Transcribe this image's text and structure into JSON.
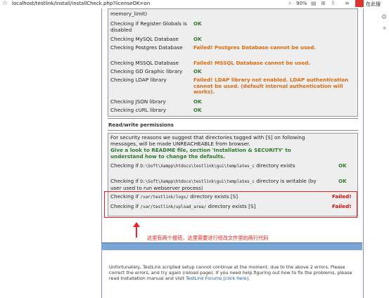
{
  "browser": {
    "url": "localhost/testlink/install/installCheck.php?licenseOK=on",
    "zoom": "90%",
    "search_label": "在此搜",
    "icons": [
      "bookmark-star-icon",
      "reader-icon",
      "extensions-icon",
      "menu-icon",
      "search-icon"
    ]
  },
  "checks_top": [
    {
      "label": "memory_limit)",
      "status": "",
      "status_class": ""
    },
    {
      "label": "Checking if Register Globals is disabled",
      "status": "OK",
      "status_class": "ok"
    },
    {
      "label": "Checking MySQL Database",
      "status": "OK",
      "status_class": "ok"
    },
    {
      "label": "Checking Postgres Database",
      "status": "Failed! Postgres Database cannot be used.",
      "status_class": "fail"
    },
    {
      "label": "Checking MSSQL Database",
      "status": "Failed! MSSQL Database cannot be used.",
      "status_class": "fail"
    },
    {
      "label": "Checking GD Graphic library",
      "status": "OK",
      "status_class": "ok"
    },
    {
      "label": "Checking LDAP library",
      "status": "Failed! LDAP library not enabled. LDAP authentication cannot be used. (default internal authentication will works).",
      "status_class": "fail"
    },
    {
      "label": "Checking JSON library",
      "status": "OK",
      "status_class": "ok"
    },
    {
      "label": "Checking cURL library",
      "status": "OK",
      "status_class": "ok"
    }
  ],
  "rw": {
    "title": "Read/write permissions",
    "intro": "For security reasons we suggest that directories tagged with [S] on following messages, will be made UNREACHEABLE from browser.",
    "advice": "Give a look to README file, section 'Installation & SECURITY' to understand how to change the defaults.",
    "rows": [
      {
        "prefix": "Checking if",
        "path": "D:\\Soft\\Xampp\\htdocs\\testlink\\gui\\templates_c",
        "suffix": "directory exists",
        "status": "OK"
      },
      {
        "prefix": "Checking if",
        "path": "D:\\Soft\\Xampp\\htdocs\\testlink\\gui\\templates_c",
        "suffix": "directory is writable (by user used to run webserver process)",
        "status": "OK"
      },
      {
        "prefix": "Checking if",
        "path": "/var/testlink/logs/",
        "suffix": "directory exists [S]",
        "status": "Failed!"
      },
      {
        "prefix": "Checking if",
        "path": "/var/testlink/upload_area/",
        "suffix": "directory exists [S]",
        "status": "Failed!"
      }
    ]
  },
  "annotation": "这里有两个报错，这里需要进行修改文件里的两行代码",
  "footer": {
    "text1": "Unfortunately, TestLink scripted setup cannot continue at the moment, due to the above 2 errors. Please correct the errors, and try again (reload page). If you need help figuring out how to fix the problems, please read Installation manual and visit",
    "link": "TestLink Forums [click here]",
    "text2": "."
  },
  "colors": {
    "ok": "#2e7a2e",
    "fail": "#e26b10",
    "failed_red": "#cc1111",
    "band": "#7aa6d8",
    "annotation": "#e22222"
  }
}
